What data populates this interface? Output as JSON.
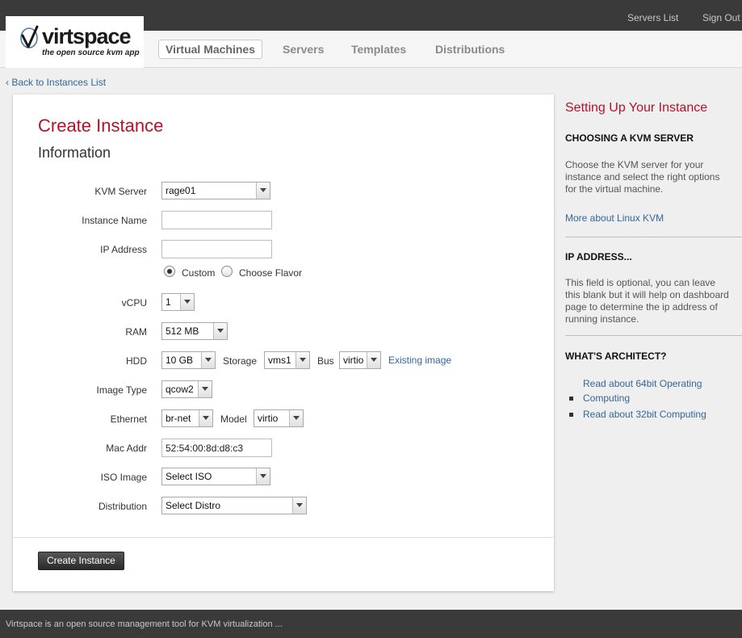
{
  "toplinks": {
    "servers_list": "Servers List",
    "sign_out": "Sign Out"
  },
  "logo": {
    "name": "virtspace",
    "tagline": "the open source kvm app"
  },
  "nav": {
    "items": [
      "Virtual Machines",
      "Servers",
      "Templates",
      "Distributions"
    ],
    "active": "Virtual Machines"
  },
  "back_link": "‹ Back to Instances List",
  "form": {
    "title": "Create Instance",
    "section": "Information",
    "kvm_server": {
      "label": "KVM Server",
      "value": "rage01"
    },
    "instance_name": {
      "label": "Instance Name",
      "value": ""
    },
    "ip_address": {
      "label": "IP Address",
      "value": ""
    },
    "mode": {
      "custom": "Custom",
      "flavor": "Choose Flavor",
      "selected": "Custom"
    },
    "vcpu": {
      "label": "vCPU",
      "value": "1"
    },
    "ram": {
      "label": "RAM",
      "value": "512 MB"
    },
    "hdd": {
      "label": "HDD",
      "value": "10 GB",
      "storage_label": "Storage",
      "storage_value": "vms1",
      "bus_label": "Bus",
      "bus_value": "virtio",
      "existing_image": "Existing image"
    },
    "image_type": {
      "label": "Image Type",
      "value": "qcow2"
    },
    "ethernet": {
      "label": "Ethernet",
      "value": "br-net",
      "model_label": "Model",
      "model_value": "virtio"
    },
    "mac_addr": {
      "label": "Mac Addr",
      "value": "52:54:00:8d:d8:c3"
    },
    "iso_image": {
      "label": "ISO Image",
      "value": "Select ISO"
    },
    "distribution": {
      "label": "Distribution",
      "value": "Select Distro"
    },
    "submit": "Create Instance"
  },
  "sidebar": {
    "title": "Setting Up Your Instance",
    "sections": [
      {
        "heading": "CHOOSING A KVM SERVER",
        "text": "Choose the KVM server for your instance and select the right options for the virtual machine.",
        "link": "More about Linux KVM"
      },
      {
        "heading": "IP ADDRESS...",
        "text": "This field is optional, you can leave this blank but it will help on dashboard page to determine the ip address of running instance."
      },
      {
        "heading": "WHAT'S ARCHITECT?",
        "links": [
          "Read about 64bit Operating Computing",
          "Read about 32bit Computing"
        ]
      }
    ]
  },
  "footer": "Virtspace is an open source management tool for KVM virtualization ...",
  "colors": {
    "accent_red": "#b5122a",
    "link_blue": "#336699",
    "dark_bar": "#3a3a3a"
  }
}
